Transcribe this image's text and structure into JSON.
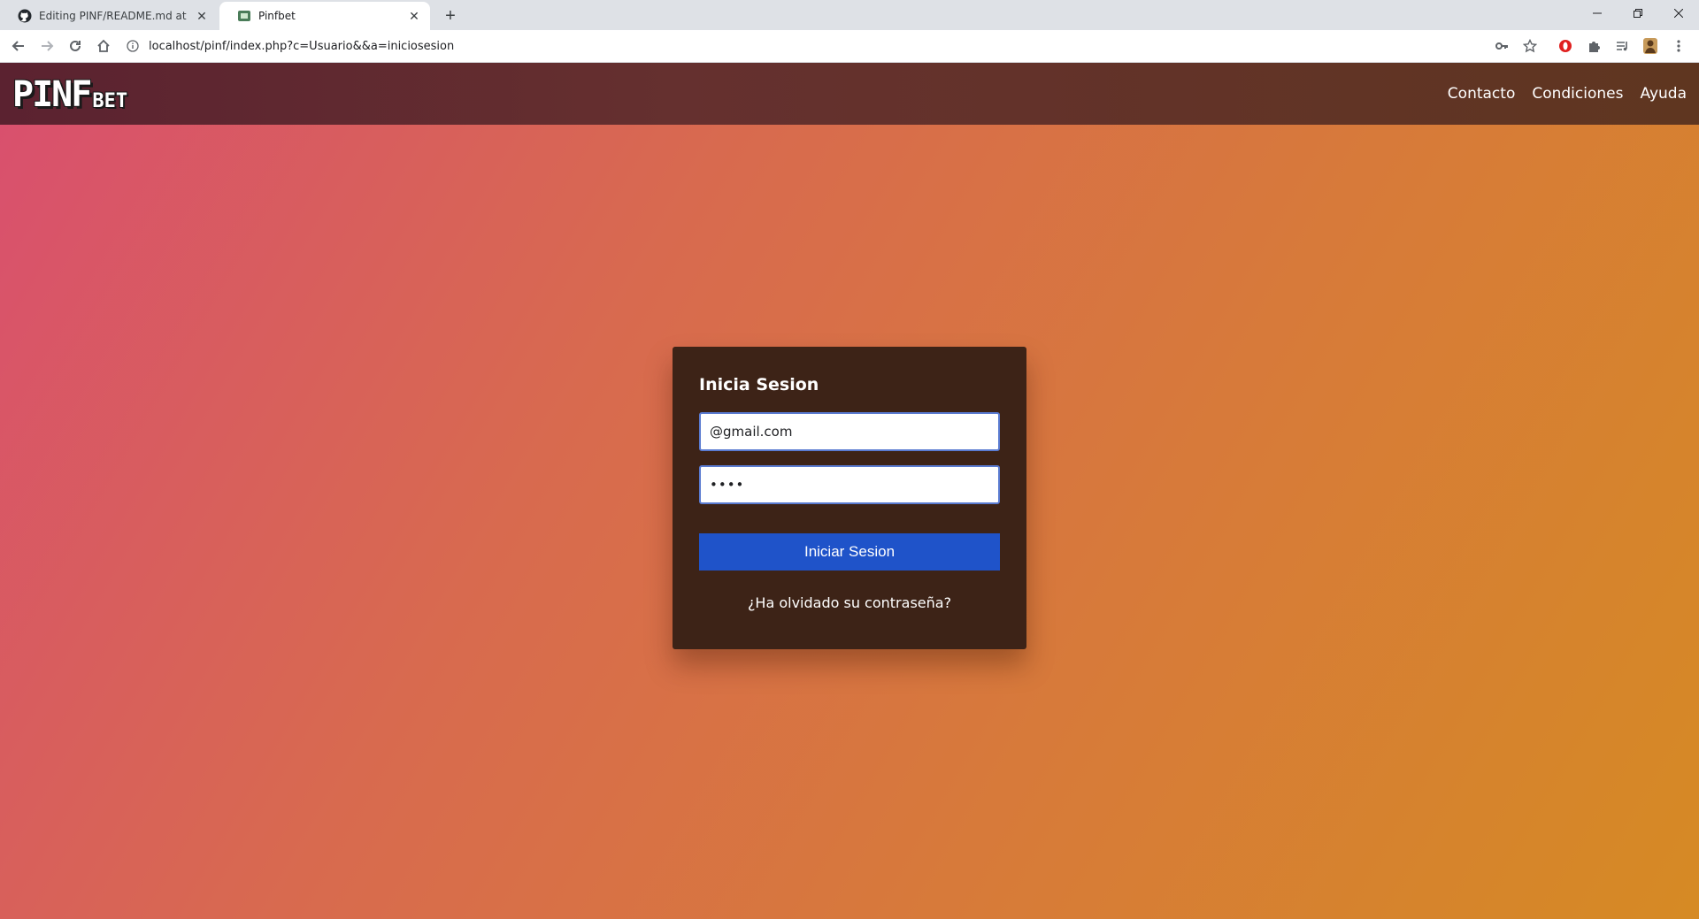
{
  "browser": {
    "tabs": [
      {
        "title": "Editing PINF/README.md at mas",
        "favicon": "github-icon",
        "active": false
      },
      {
        "title": "Pinfbet",
        "favicon": "site-icon",
        "active": true
      }
    ],
    "new_tab": "+",
    "url": "localhost/pinf/index.php?c=Usuario&&a=iniciosesion",
    "toolbar_icons": [
      "back-icon",
      "forward-icon",
      "reload-icon",
      "home-icon",
      "info-icon",
      "key-icon",
      "star-icon",
      "opera-icon",
      "puzzle-icon",
      "media-icon",
      "profile-icon",
      "menu-icon"
    ],
    "window_controls": [
      "minimize-icon",
      "restore-icon",
      "close-icon"
    ]
  },
  "site": {
    "logo_big": "PINF",
    "logo_small": "BET",
    "nav": [
      "Contacto",
      "Condiciones",
      "Ayuda"
    ]
  },
  "login": {
    "title": "Inicia Sesion",
    "email_value": "@gmail.com",
    "password_value": "••••",
    "submit_label": "Iniciar Sesion",
    "forgot_label": "¿Ha olvidado su contraseña?"
  },
  "colors": {
    "accent_button": "#1f53c9",
    "card_bg": "#3d2317",
    "header_bg": "#5b2230"
  }
}
